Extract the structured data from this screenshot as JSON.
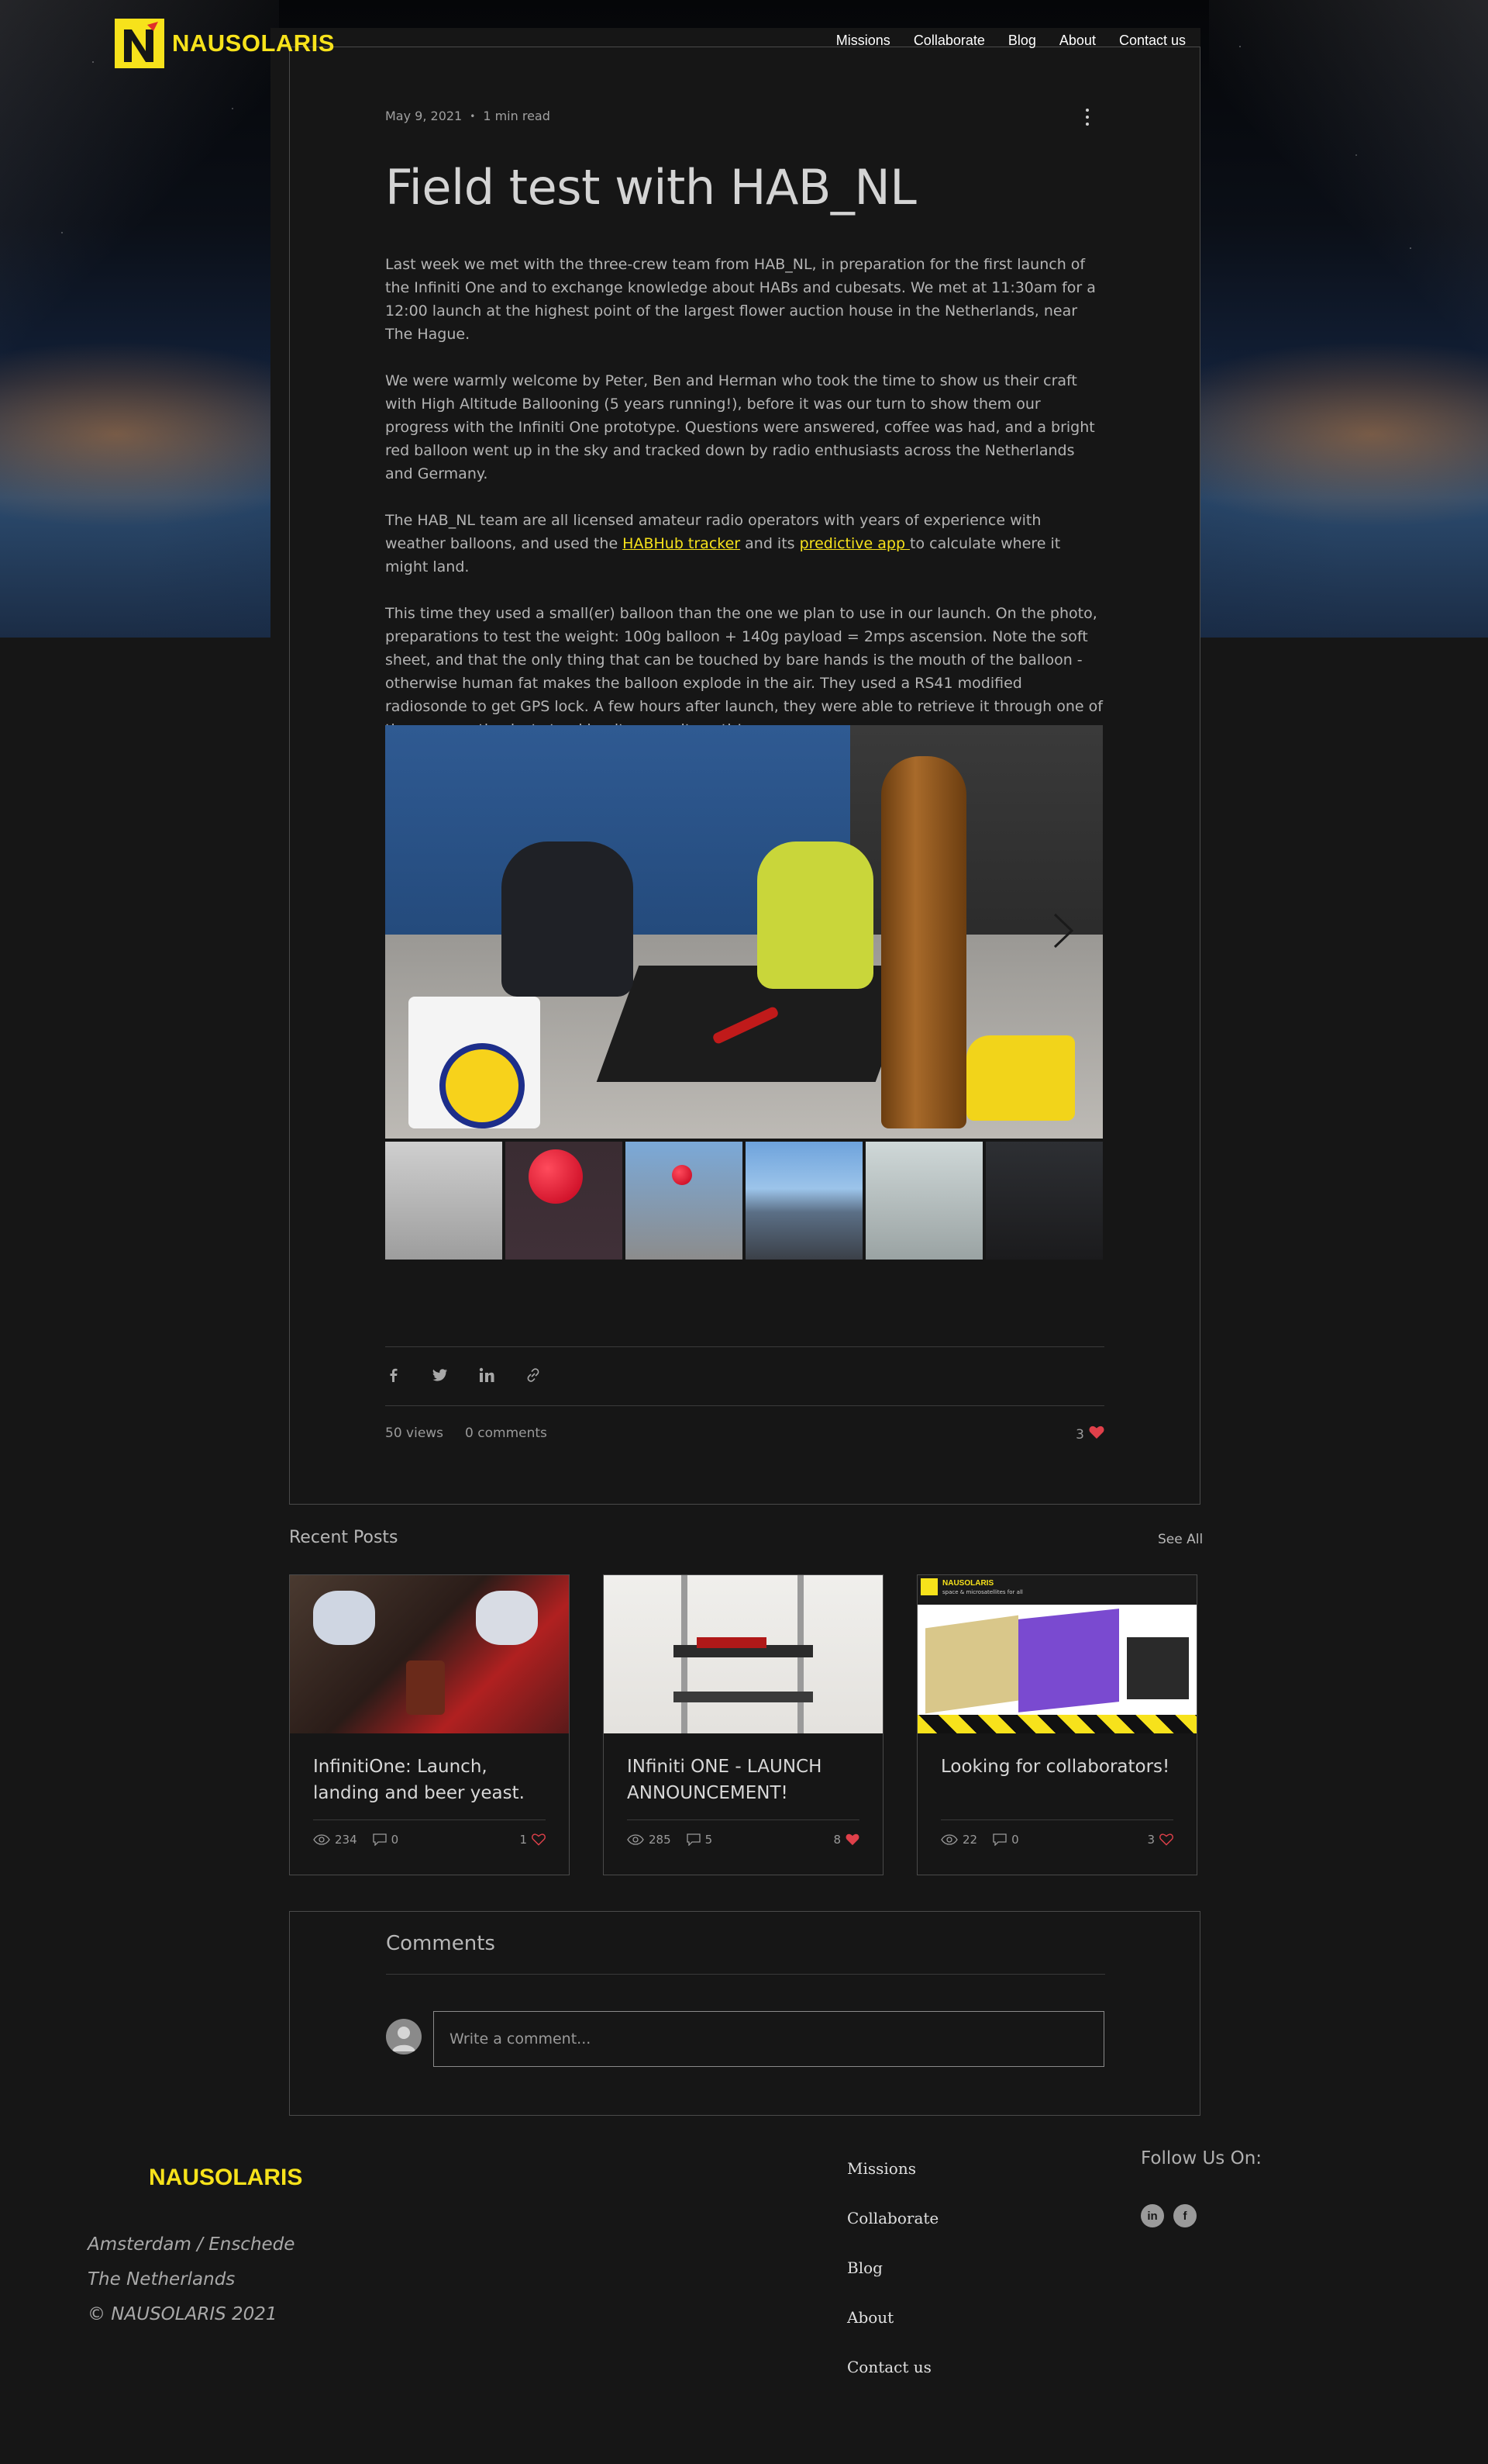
{
  "header": {
    "logo_text": "NAUSOLARIS",
    "nav": [
      "Missions",
      "Collaborate",
      "Blog",
      "About",
      "Contact us"
    ]
  },
  "post": {
    "date": "May 9, 2021",
    "read_time": "1 min read",
    "title": "Field test with HAB_NL",
    "paragraphs": [
      "Last week we met with the three-crew team from HAB_NL, in preparation for the first launch of the Infiniti One and to exchange knowledge about HABs and cubesats. We met at 11:30am for a 12:00 launch at the highest point of the largest flower auction house in the Netherlands, near The Hague.",
      "We were warmly welcome by Peter, Ben and Herman who took the time to show us their craft with High Altitude Ballooning (5 years running!), before it was our turn to show them our progress with the Infiniti One prototype. Questions were answered, coffee was had, and a bright red balloon went up in the sky and tracked down by radio enthusiasts across the Netherlands and Germany.",
      "This time they used a small(er) balloon than the one we plan to use in our launch. On the photo, preparations to test the weight: 100g balloon + 140g payload = 2mps ascension. Note the soft sheet, and that the only thing that can be touched by bare hands is the mouth of the balloon - otherwise human fat makes the balloon explode in the air. They used a RS41 modified radiosonde to get GPS lock. A few hours after launch, they were able to retrieve it through one of the many enthusiasts tracking it across its path!"
    ],
    "p3": {
      "before": "The HAB_NL team are all licensed amateur radio operators with years of experience with weather balloons, and used the ",
      "link1": "HABHub tracker",
      "middle": " and its ",
      "link2": "predictive app ",
      "after": "to calculate where it might land."
    },
    "views": "50 views",
    "comments": "0 comments",
    "likes": "3"
  },
  "recent": {
    "title": "Recent Posts",
    "see_all": "See All",
    "posts": [
      {
        "title": "InfinitiOne: Launch, landing and beer yeast.",
        "views": "234",
        "comments": "0",
        "likes": "1"
      },
      {
        "title": "INfiniti ONE - LAUNCH ANNOUNCEMENT!",
        "views": "285",
        "comments": "5",
        "likes": "8"
      },
      {
        "title": "Looking for collaborators!",
        "views": "22",
        "comments": "0",
        "likes": "3"
      }
    ],
    "thumb3_banner_title": "NAUSOLARIS",
    "thumb3_banner_sub": "space & microsatellites for all"
  },
  "comments_section": {
    "title": "Comments",
    "placeholder": "Write a comment..."
  },
  "footer": {
    "logo_text": "NAUSOLARIS",
    "address": [
      "Amsterdam / Enschede",
      "The Netherlands",
      "© NAUSOLARIS 2021"
    ],
    "nav": [
      "Missions",
      "Collaborate",
      "Blog",
      "About",
      "Contact us"
    ],
    "follow": "Follow Us On:",
    "social": [
      "linkedin-icon",
      "facebook-icon"
    ]
  },
  "colors": {
    "brand_yellow": "#f7e21b",
    "background": "#161616",
    "heart": "#e0404a"
  }
}
